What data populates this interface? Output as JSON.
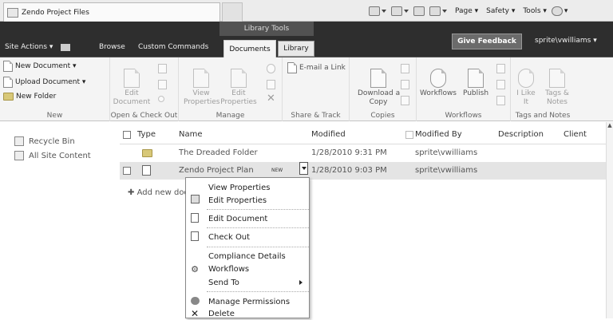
{
  "browser": {
    "tab_title": "Zendo Project Files",
    "commands": {
      "page": "Page ▾",
      "safety": "Safety ▾",
      "tools": "Tools ▾",
      "help": "▾"
    }
  },
  "ribbon": {
    "site_actions": "Site Actions ▾",
    "browse": "Browse",
    "custom_commands": "Custom Commands",
    "context_group": "Library Tools",
    "documents": "Documents",
    "library": "Library",
    "give_feedback": "Give Feedback",
    "user": "sprite\\vwilliams ▾"
  },
  "groups": {
    "new": {
      "label": "New",
      "new_document": "New Document ▾",
      "upload_document": "Upload Document ▾",
      "new_folder": "New Folder"
    },
    "open_check_out": {
      "label": "Open & Check Out",
      "edit_document": "Edit\nDocument"
    },
    "manage": {
      "label": "Manage",
      "view_properties": "View\nProperties",
      "edit_properties": "Edit\nProperties"
    },
    "share_track": {
      "label": "Share & Track",
      "email_link": "E-mail a Link"
    },
    "copies": {
      "label": "Copies",
      "download_copy": "Download a\nCopy"
    },
    "workflows": {
      "label": "Workflows",
      "workflows": "Workflows",
      "publish": "Publish"
    },
    "tags_notes": {
      "label": "Tags and Notes",
      "i_like_it": "I Like\nIt",
      "tags_notes": "Tags &\nNotes"
    }
  },
  "leftnav": [
    {
      "label": "Recycle Bin"
    },
    {
      "label": "All Site Content"
    }
  ],
  "list": {
    "headers": {
      "type": "Type",
      "name": "Name",
      "modified": "Modified",
      "modified_by": "Modified By",
      "description": "Description",
      "client": "Client"
    },
    "rows": [
      {
        "name": "The Dreaded Folder",
        "modified": "1/28/2010 9:31 PM",
        "modified_by": "sprite\\vwilliams"
      },
      {
        "name": "Zendo Project Plan",
        "new_badge": "NEW",
        "modified": "1/28/2010 9:03 PM",
        "modified_by": "sprite\\vwilliams"
      }
    ],
    "add_new": "Add new doc"
  },
  "context_menu": {
    "items": [
      "View Properties",
      "Edit Properties",
      "Edit Document",
      "Check Out",
      "Compliance Details",
      "Workflows",
      "Send To",
      "Manage Permissions",
      "Delete"
    ]
  },
  "icons": {
    "delete": "✕",
    "workflows": "gear",
    "add": "✚"
  }
}
